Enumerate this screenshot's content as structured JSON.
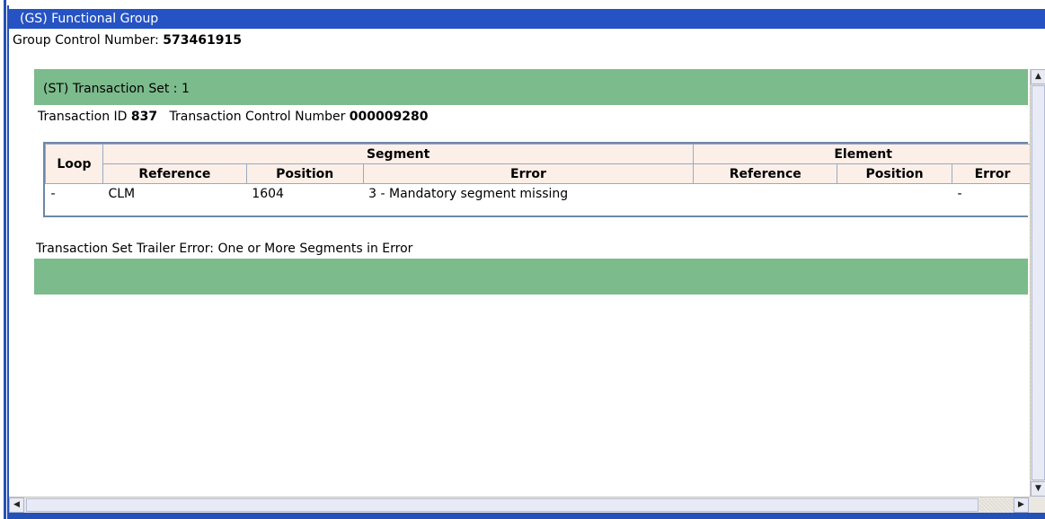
{
  "window": {
    "title": "(GS) Functional Group"
  },
  "group": {
    "label": "Group Control Number: ",
    "number": "573461915"
  },
  "transaction_set": {
    "header": "(ST) Transaction Set : 1",
    "id_label": "Transaction ID ",
    "id_value": "837",
    "control_label": "Transaction Control Number ",
    "control_value": "000009280",
    "trailer": "Transaction Set Trailer Error: One or More Segments in Error"
  },
  "table": {
    "loop_header": "Loop",
    "segment_header": "Segment",
    "element_header": "Element",
    "columns": [
      "Reference",
      "Position",
      "Error",
      "Reference",
      "Position",
      "Error"
    ],
    "rows": [
      {
        "loop": "-",
        "seg_ref": "CLM",
        "seg_pos": "1604",
        "seg_err": "3 - Mandatory segment missing",
        "el_ref": "",
        "el_pos": "",
        "el_err": "-"
      }
    ]
  },
  "colors": {
    "titlebar": "#2553c3",
    "panel_green": "#7cbb8c",
    "header_bg": "#fcefe8",
    "table_border": "#6f86a8"
  }
}
